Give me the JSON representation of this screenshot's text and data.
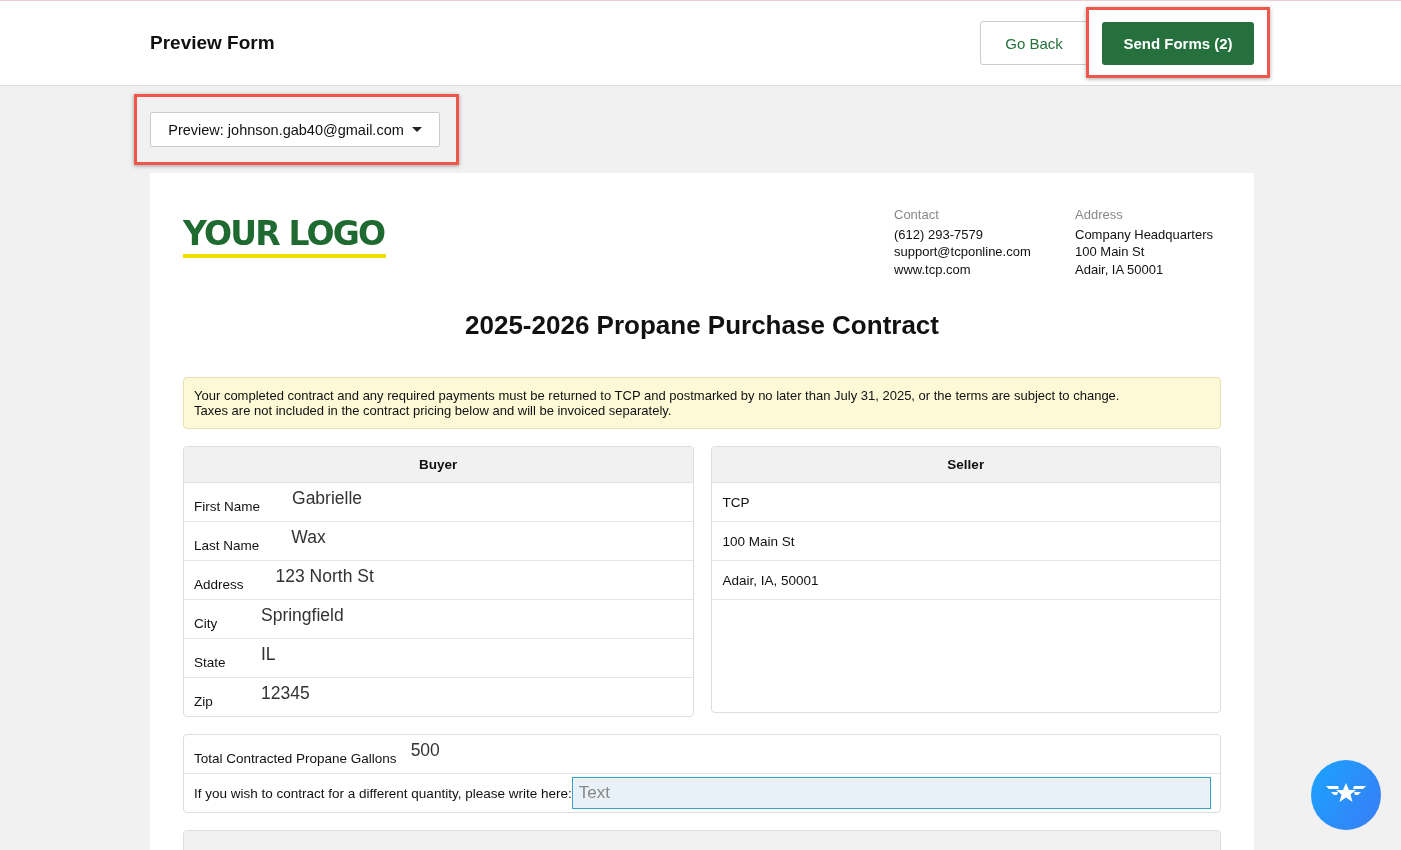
{
  "header": {
    "title": "Preview Form",
    "buttons": [
      {
        "kind": "secondary",
        "label": "Go Back",
        "highlighted": false
      },
      {
        "kind": "primary",
        "label": "Send Forms (2)",
        "highlighted": true
      }
    ]
  },
  "preview_select": {
    "value": "Preview: johnson.gab40@gmail.com",
    "highlighted": true
  },
  "document": {
    "logo": "YOUR LOGO",
    "contact": {
      "heading": "Contact",
      "lines": [
        "(612) 293-7579",
        "support@tcponline.com",
        "www.tcp.com"
      ]
    },
    "address": {
      "heading": "Address",
      "lines": [
        "Company Headquarters",
        "100 Main St",
        "Adair, IA 50001"
      ]
    },
    "title": "2025-2026 Propane Purchase Contract",
    "notice": [
      "Your completed contract and any required payments must be returned to TCP and postmarked by no later than July 31, 2025, or the terms are subject to change.",
      "Taxes are not included in the contract pricing below and will be invoiced separately."
    ],
    "buyer": {
      "heading": "Buyer",
      "rows": [
        {
          "label": "First Name",
          "value": "Gabrielle"
        },
        {
          "label": "Last Name",
          "value": "Wax"
        },
        {
          "label": "Address",
          "value": "123 North St"
        },
        {
          "label": "City",
          "value": "Springfield"
        },
        {
          "label": "State",
          "value": "IL"
        },
        {
          "label": "Zip",
          "value": "12345"
        }
      ]
    },
    "seller": {
      "heading": "Seller",
      "rows": [
        "TCP",
        "100 Main St",
        "Adair, IA, 50001"
      ]
    },
    "gallons": {
      "label": "Total Contracted Propane Gallons",
      "value": "500"
    },
    "different_quantity": {
      "label": "If you wish to contract for a different quantity, please write here:",
      "placeholder": "Text"
    }
  }
}
